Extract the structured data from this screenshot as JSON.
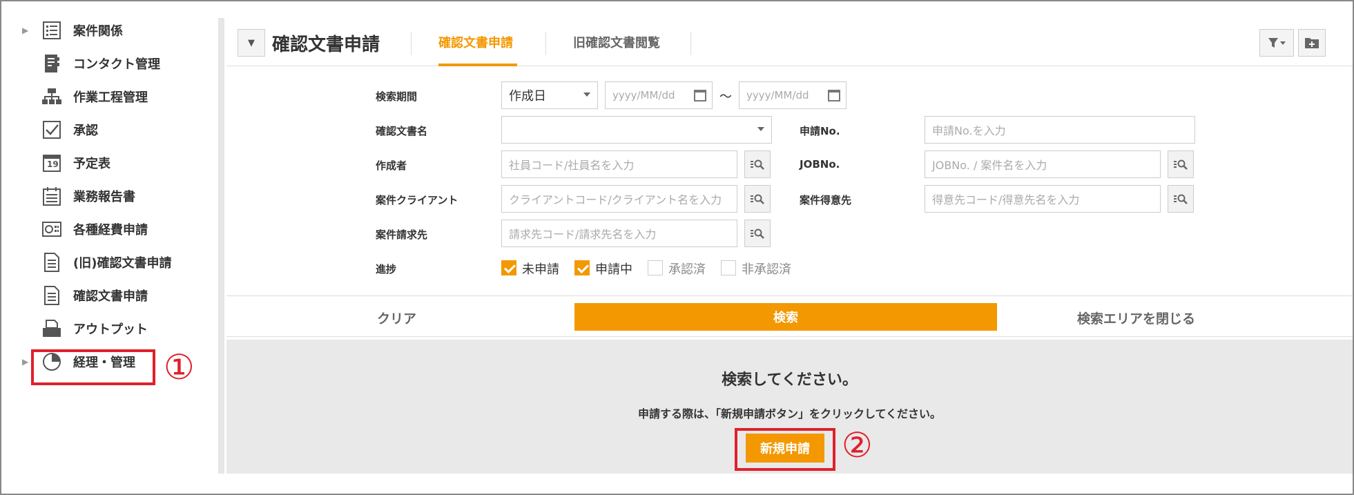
{
  "sidebar": {
    "items": [
      {
        "label": "案件関係",
        "icon": "list-icon",
        "expandable": true
      },
      {
        "label": "コンタクト管理",
        "icon": "contact-book-icon",
        "expandable": false
      },
      {
        "label": "作業工程管理",
        "icon": "org-chart-icon",
        "expandable": false
      },
      {
        "label": "承認",
        "icon": "checkbox-icon",
        "expandable": false
      },
      {
        "label": "予定表",
        "icon": "calendar-icon",
        "calendar_day": "19",
        "expandable": false
      },
      {
        "label": "業務報告書",
        "icon": "report-icon",
        "expandable": false
      },
      {
        "label": "各種経費申請",
        "icon": "expense-icon",
        "expandable": false
      },
      {
        "label": "(旧)確認文書申請",
        "icon": "document-icon",
        "expandable": false
      },
      {
        "label": "確認文書申請",
        "icon": "document-icon",
        "expandable": false,
        "highlighted": true
      },
      {
        "label": "アウトプット",
        "icon": "output-tray-icon",
        "expandable": false
      },
      {
        "label": "経理・管理",
        "icon": "pie-chart-icon",
        "expandable": true
      }
    ]
  },
  "annotations": {
    "marker1": "①",
    "marker2": "②",
    "color": "#e0202a"
  },
  "header": {
    "title": "確認文書申請",
    "tabs": [
      {
        "label": "確認文書申請",
        "active": true
      },
      {
        "label": "旧確認文書閲覧",
        "active": false
      }
    ]
  },
  "form": {
    "period_label": "検索期間",
    "period_select": "作成日",
    "date_from_placeholder": "yyyy/MM/dd",
    "date_to_placeholder": "yyyy/MM/dd",
    "range_sep": "～",
    "doc_name_label": "確認文書名",
    "doc_name_value": "",
    "apply_no_label": "申請No.",
    "apply_no_placeholder": "申請No.を入力",
    "creator_label": "作成者",
    "creator_placeholder": "社員コード/社員名を入力",
    "job_no_label": "JOBNo.",
    "job_no_placeholder": "JOBNo. / 案件名を入力",
    "client_label": "案件クライアント",
    "client_placeholder": "クライアントコード/クライアント名を入力",
    "customer_label": "案件得意先",
    "customer_placeholder": "得意先コード/得意先名を入力",
    "billing_label": "案件請求先",
    "billing_placeholder": "請求先コード/請求先名を入力",
    "progress_label": "進捗",
    "progress_options": [
      {
        "label": "未申請",
        "checked": true
      },
      {
        "label": "申請中",
        "checked": true
      },
      {
        "label": "承認済",
        "checked": false
      },
      {
        "label": "非承認済",
        "checked": false
      }
    ]
  },
  "actions": {
    "clear": "クリア",
    "search": "検索",
    "close_area": "検索エリアを閉じる"
  },
  "result": {
    "title": "検索してください。",
    "subtitle": "申請する際は、「新規申請ボタン」をクリックしてください。",
    "new_button": "新規申請"
  },
  "colors": {
    "accent": "#f39800",
    "annotation": "#e0202a"
  }
}
